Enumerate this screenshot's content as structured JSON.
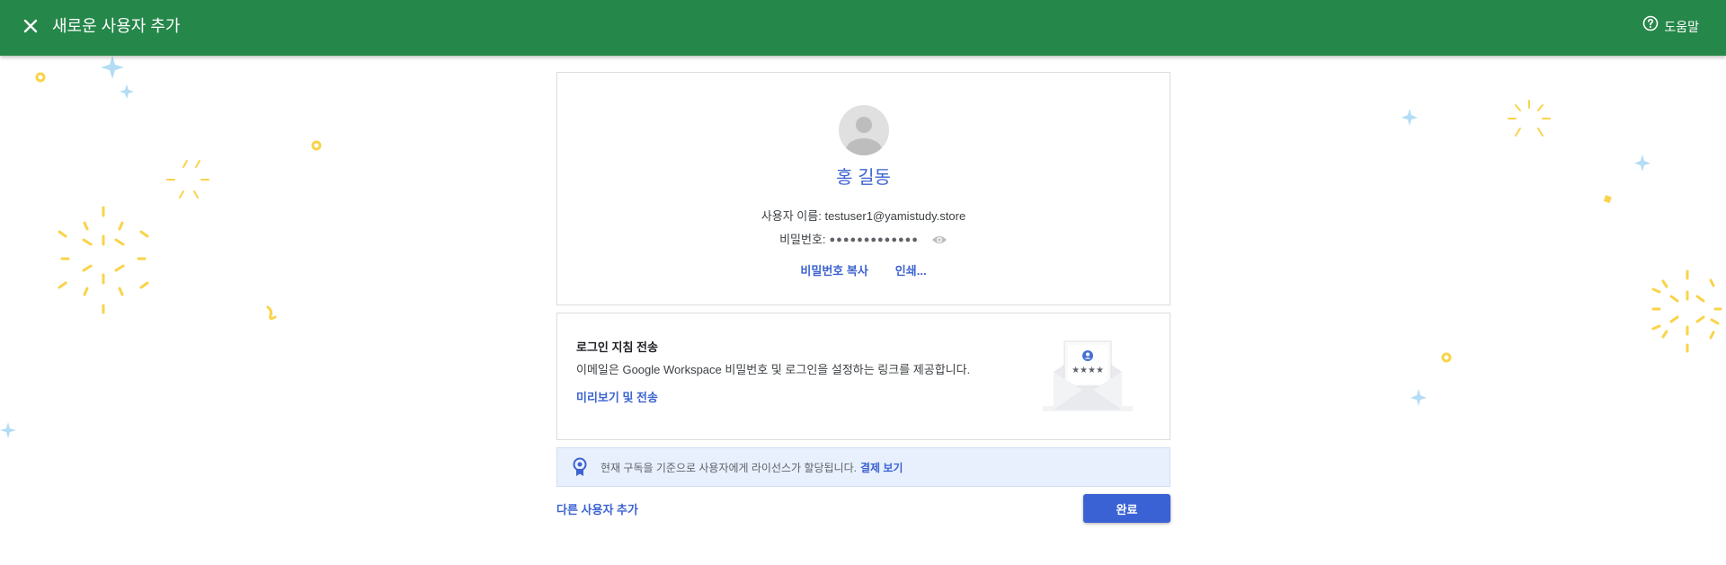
{
  "header": {
    "title": "새로운 사용자 추가",
    "help_label": "도움말",
    "background_color": "#26874a"
  },
  "user_card": {
    "display_name": "홍 길동",
    "username_label": "사용자 이름:",
    "username_value": "testuser1@yamistudy.store",
    "password_label": "비밀번호:",
    "password_masked": "●●●●●●●●●●●●●",
    "copy_password_label": "비밀번호 복사",
    "print_label": "인쇄..."
  },
  "login_card": {
    "title": "로그인 지침 전송",
    "description": "이메일은 Google Workspace 비밀번호 및 로그인을 설정하는 링크를 제공합니다.",
    "preview_send_label": "미리보기 및 전송",
    "envelope_stars": "★★★★"
  },
  "license_banner": {
    "text": "현재 구독을 기준으로 사용자에게 라이선스가 할당됩니다.",
    "link_label": "결제 보기"
  },
  "footer": {
    "add_another_label": "다른 사용자 추가",
    "done_label": "완료"
  },
  "colors": {
    "accent": "#3c63d0",
    "confetti_yellow": "#f9d34a",
    "confetti_blue": "#b3dcf5"
  }
}
